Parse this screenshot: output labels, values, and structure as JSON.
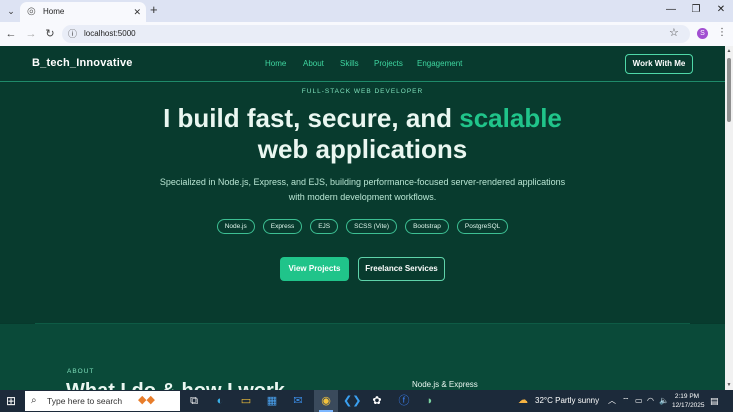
{
  "browser": {
    "tab_title": "Home",
    "url": "localhost:5000",
    "profile_initial": "S"
  },
  "site": {
    "brand": "B_tech_Innovative",
    "nav": [
      "Home",
      "About",
      "Skills",
      "Projects",
      "Engagement"
    ],
    "cta": "Work With Me"
  },
  "hero": {
    "eyebrow": "FULL-STACK WEB DEVELOPER",
    "headline_part1": "I build fast, secure, and ",
    "headline_accent": "scalable",
    "headline_part2": "web applications",
    "subtitle_line1": "Specialized in Node.js, Express, and EJS, building performance-focused server-rendered applications",
    "subtitle_line2": "with modern development workflows.",
    "chips": [
      "Node.js",
      "Express",
      "EJS",
      "SCSS (Vite)",
      "Bootstrap",
      "PostgreSQL"
    ],
    "primary_button": "View Projects",
    "secondary_button": "Freelance Services"
  },
  "about": {
    "label": "ABOUT",
    "heading": "What I do & how I work",
    "card_title": "Node.js & Express"
  },
  "taskbar": {
    "search_placeholder": "Type here to search",
    "weather_temp": "32°C",
    "weather_desc": "Partly sunny",
    "time": "2:19 PM",
    "date": "12/17/2025"
  },
  "colors": {
    "page_bg": "#07392c",
    "accent": "#20c48a",
    "nav_link": "#3fd6a0"
  }
}
